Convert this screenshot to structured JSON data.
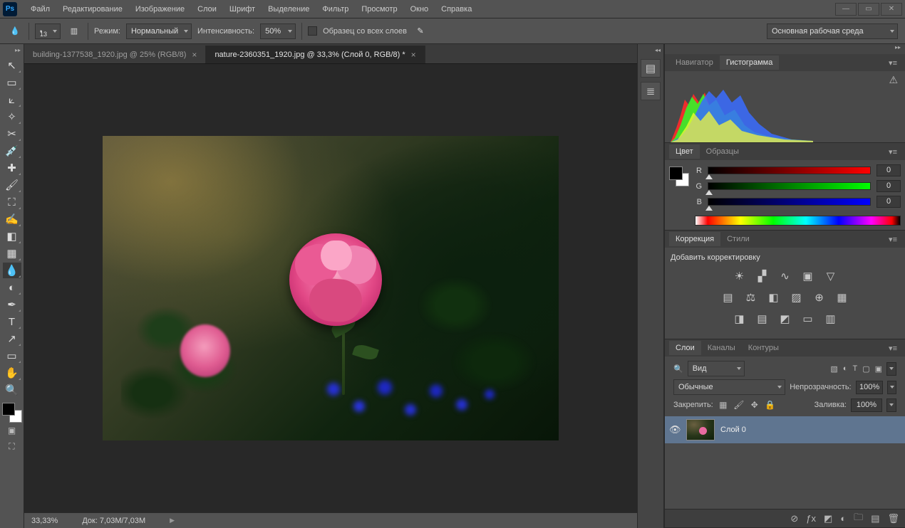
{
  "app": {
    "icon_text": "Ps"
  },
  "menu": [
    "Файл",
    "Редактирование",
    "Изображение",
    "Слои",
    "Шрифт",
    "Выделение",
    "Фильтр",
    "Просмотр",
    "Окно",
    "Справка"
  ],
  "optbar": {
    "brush_size": "13",
    "mode_label": "Режим:",
    "mode_value": "Нормальный",
    "strength_label": "Интенсивность:",
    "strength_value": "50%",
    "sample_all": "Образец со всех слоев",
    "workspace": "Основная рабочая среда"
  },
  "tabs": [
    {
      "label": "building-1377538_1920.jpg @ 25% (RGB/8)",
      "active": false
    },
    {
      "label": "nature-2360351_1920.jpg @ 33,3% (Слой 0, RGB/8) *",
      "active": true
    }
  ],
  "status": {
    "zoom": "33,33%",
    "doc": "Док: 7,03M/7,03M"
  },
  "panels": {
    "nav": {
      "tabs": [
        "Навигатор",
        "Гистограмма"
      ],
      "active": 1
    },
    "color": {
      "tabs": [
        "Цвет",
        "Образцы"
      ],
      "active": 0,
      "channels": [
        {
          "l": "R",
          "v": "0"
        },
        {
          "l": "G",
          "v": "0"
        },
        {
          "l": "B",
          "v": "0"
        }
      ]
    },
    "adjust": {
      "tabs": [
        "Коррекция",
        "Стили"
      ],
      "active": 0,
      "title": "Добавить корректировку"
    },
    "layers": {
      "tabs": [
        "Слои",
        "Каналы",
        "Контуры"
      ],
      "active": 0,
      "kind": "Вид",
      "blend": "Обычные",
      "opacity_label": "Непрозрачность:",
      "opacity_value": "100%",
      "lock_label": "Закрепить:",
      "fill_label": "Заливка:",
      "fill_value": "100%",
      "items": [
        {
          "name": "Слой 0"
        }
      ]
    }
  },
  "tools": [
    "move",
    "marquee",
    "lasso",
    "wand",
    "crop",
    "eyedropper",
    "heal",
    "brush",
    "stamp",
    "history-brush",
    "eraser",
    "gradient",
    "blur",
    "dodge",
    "pen",
    "type",
    "path-select",
    "shape",
    "hand",
    "zoom"
  ]
}
